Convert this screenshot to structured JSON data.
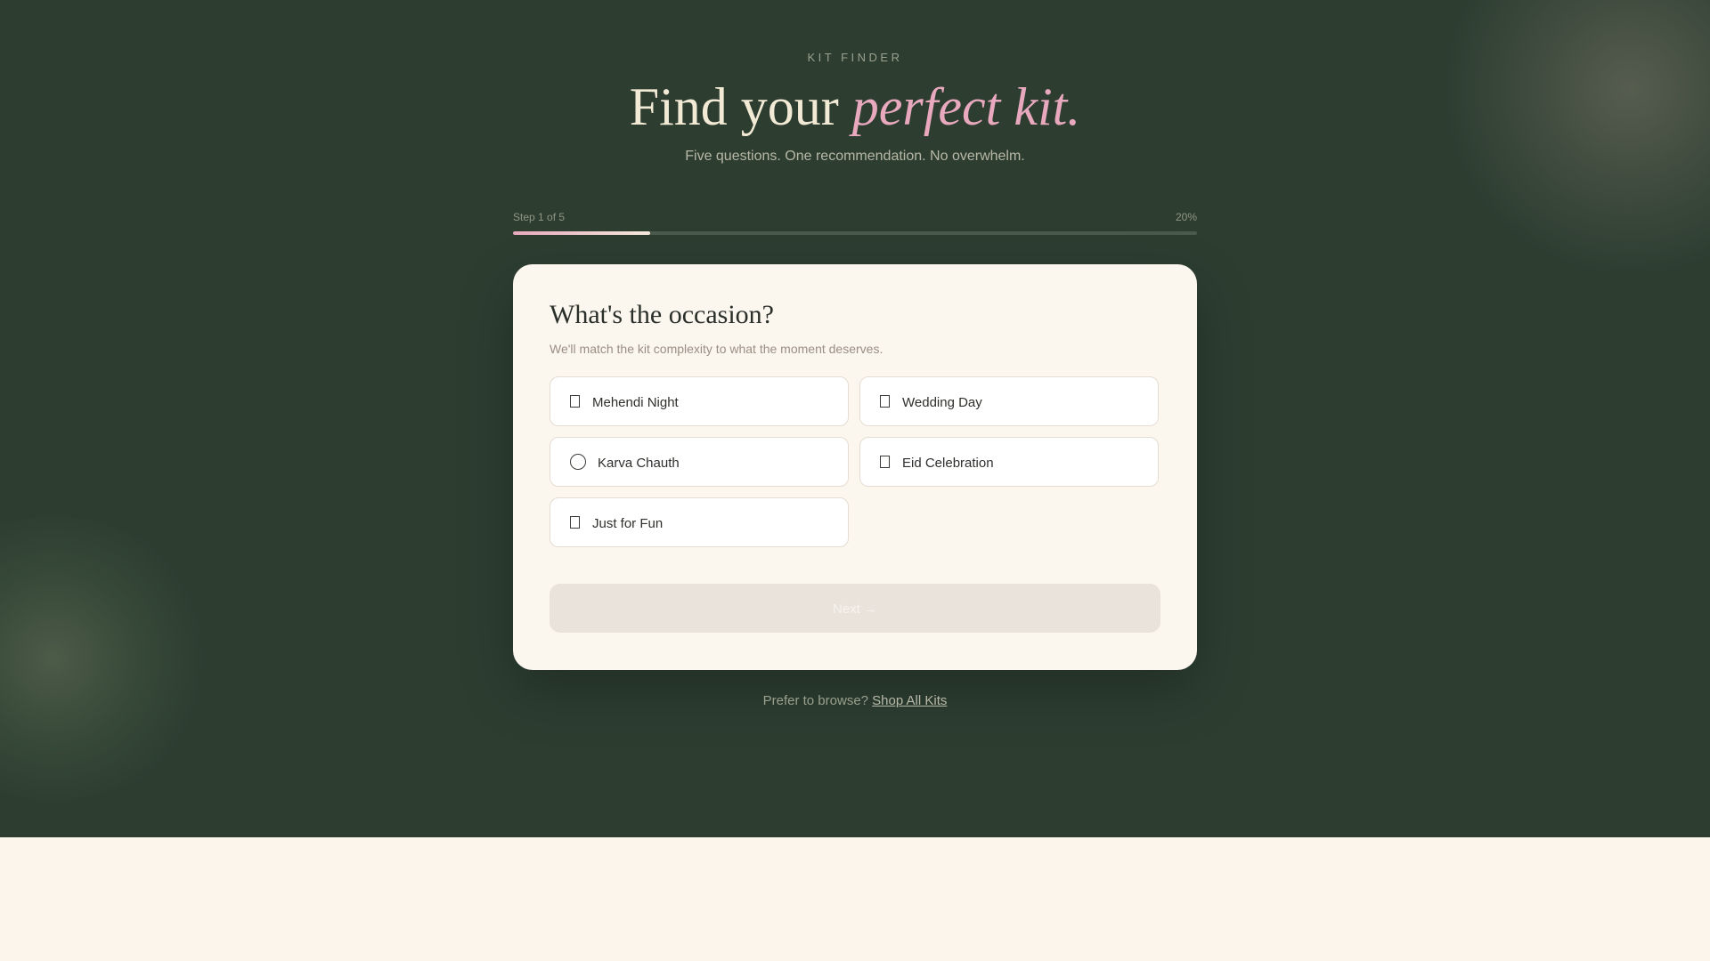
{
  "header": {
    "eyebrow": "KIT FINDER",
    "title_plain": "Find your ",
    "title_accent": "perfect kit.",
    "subtitle": "Five questions. One recommendation. No overwhelm."
  },
  "progress": {
    "step_label": "Step 1 of 5",
    "percent_label": "20%",
    "fraction": 0.2
  },
  "question": {
    "title": "What's the occasion?",
    "subtitle": "We'll match the kit complexity to what the moment deserves.",
    "options": [
      {
        "label": "Mehendi Night",
        "icon": "box-icon"
      },
      {
        "label": "Wedding Day",
        "icon": "box-icon"
      },
      {
        "label": "Karva Chauth",
        "icon": "moon-circle-icon"
      },
      {
        "label": "Eid Celebration",
        "icon": "box-icon"
      },
      {
        "label": "Just for Fun",
        "icon": "box-icon"
      }
    ],
    "next_label": "Next →"
  },
  "footer": {
    "prompt": "Prefer to browse? ",
    "link": "Shop All Kits"
  },
  "colors": {
    "background": "#2d3e31",
    "accent_pink": "#e8a9be",
    "card": "#fbf6ee"
  }
}
